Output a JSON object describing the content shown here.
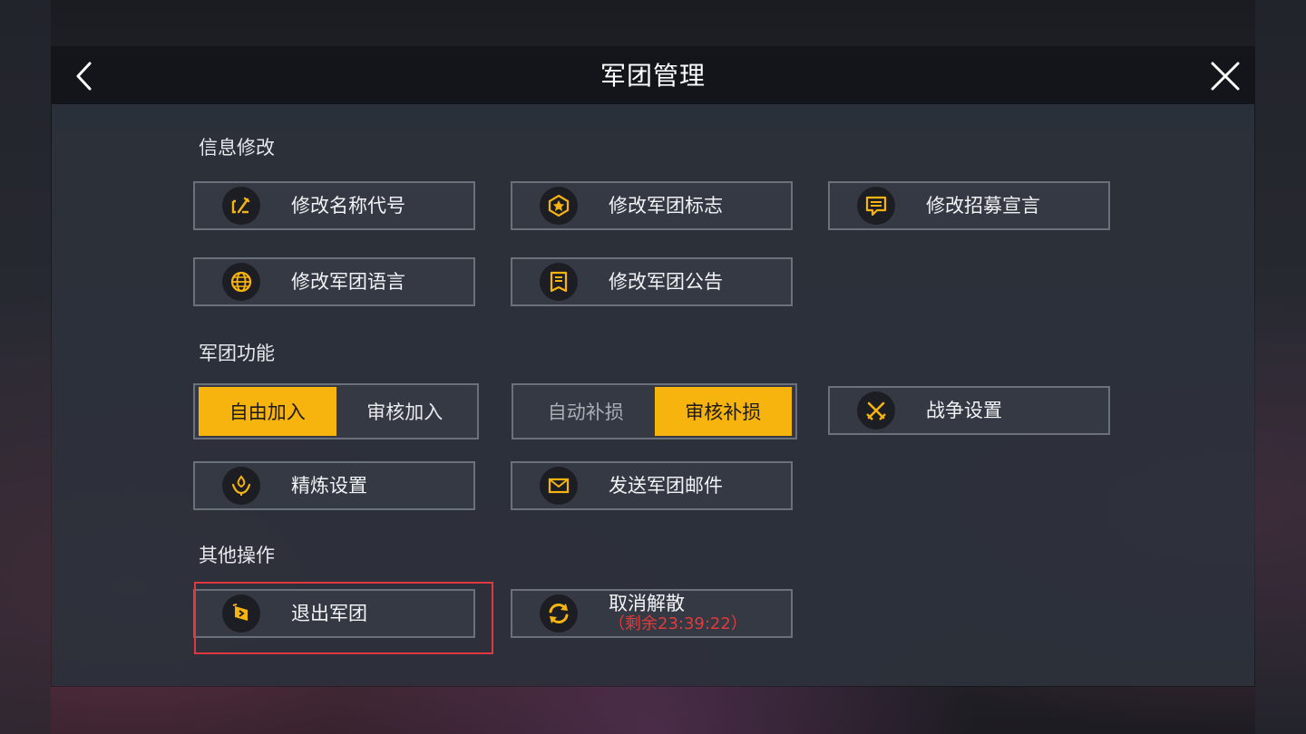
{
  "header": {
    "title": "军团管理"
  },
  "sections": {
    "info": {
      "label": "信息修改",
      "buttons": {
        "rename": "修改名称代号",
        "emblem": "修改军团标志",
        "recruit": "修改招募宣言",
        "language": "修改军团语言",
        "notice": "修改军团公告"
      }
    },
    "functions": {
      "label": "军团功能",
      "join_toggle": {
        "free": "自由加入",
        "review": "审核加入",
        "selected": "自由加入"
      },
      "repair_toggle": {
        "auto": "自动补损",
        "review": "审核补损",
        "selected": "审核补损"
      },
      "buttons": {
        "war": "战争设置",
        "refine": "精炼设置",
        "mail": "发送军团邮件"
      }
    },
    "other": {
      "label": "其他操作",
      "buttons": {
        "leave": "退出军团",
        "cancel_disband": "取消解散",
        "cancel_disband_timer": "（剩余23:39:22）"
      }
    }
  },
  "colors": {
    "accent": "#f7b30e",
    "warning": "#e03c3c",
    "highlight": "#e0383e"
  },
  "icons": {
    "back": "chevron-left-icon",
    "close": "close-icon",
    "rename": "edit-icon",
    "emblem": "emblem-icon",
    "recruit": "message-icon",
    "language": "globe-icon",
    "notice": "notice-board-icon",
    "war": "crossed-swords-icon",
    "refine": "refine-flame-icon",
    "mail": "mail-icon",
    "leave": "exit-icon",
    "cancel_disband": "refresh-icon"
  }
}
